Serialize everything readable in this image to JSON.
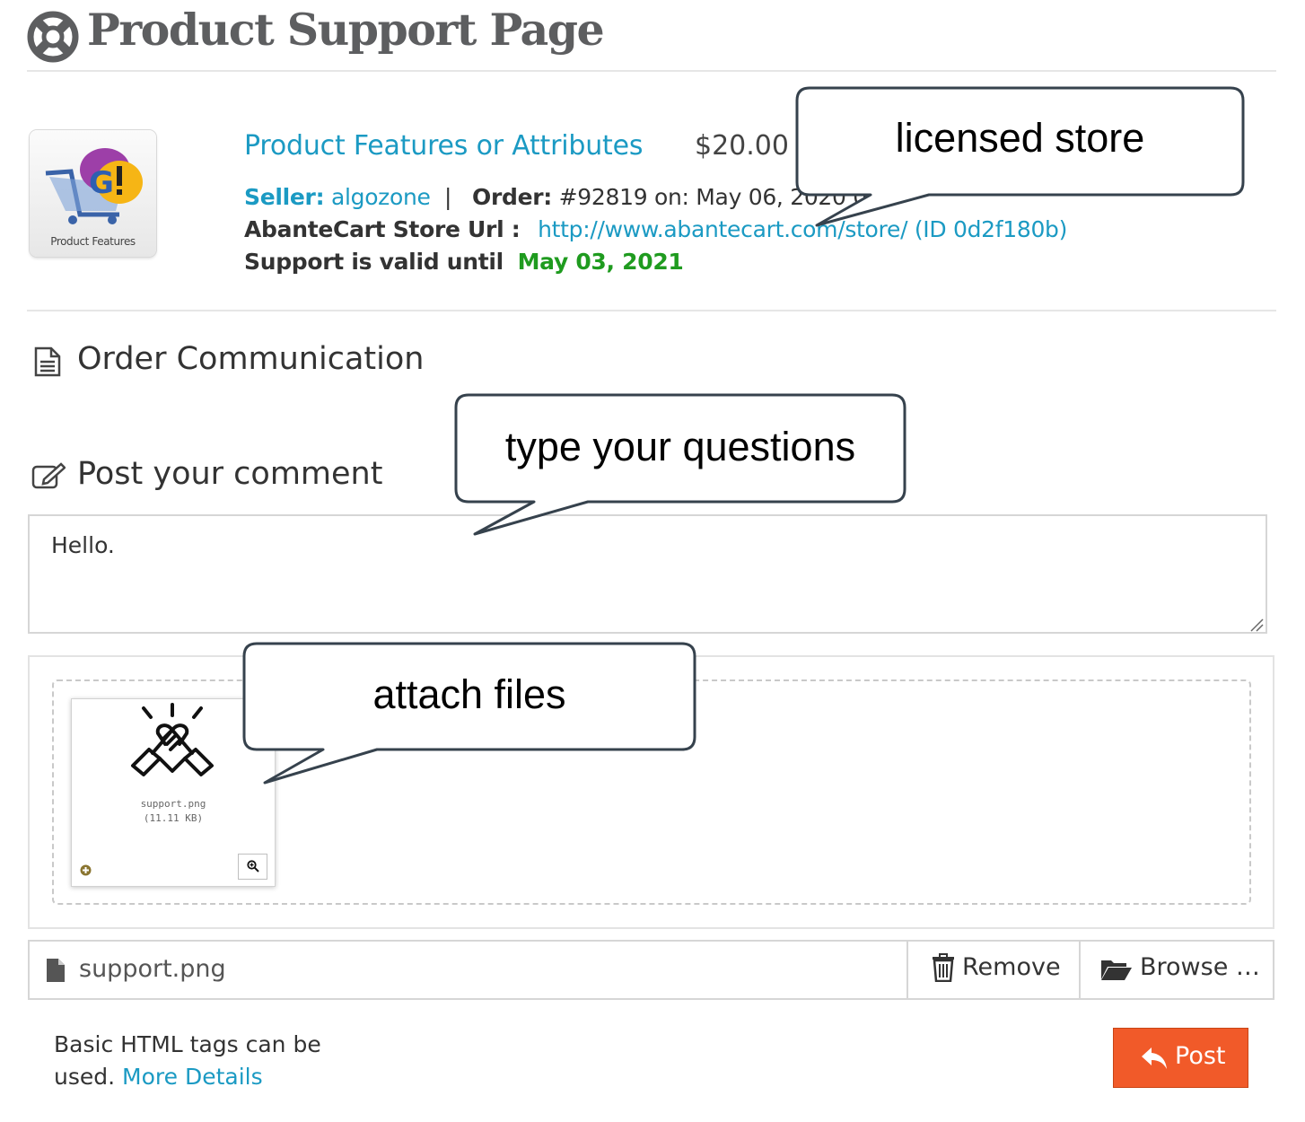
{
  "header": {
    "title": "Product Support Page",
    "icon": "life-ring-icon"
  },
  "product": {
    "thumbnail_label": "Product Features",
    "name": "Product Features or Attributes",
    "price": "$20.00",
    "seller_label": "Seller:",
    "seller": "algozone",
    "order_label": "Order:",
    "order_text": "#92819 on: May 06, 2020 07:5",
    "store_url_label": "AbanteCart Store Url :",
    "store_url": "http://www.abantecart.com/store/ (ID 0d2f180b)",
    "support_label": "Support is valid until",
    "support_until": "May 03, 2021"
  },
  "communication": {
    "title": "Order Communication",
    "icon": "document-icon"
  },
  "comment": {
    "title": "Post your comment",
    "icon": "edit-icon",
    "value": "Hello."
  },
  "upload": {
    "file_name": "support.png",
    "file_size": "(11.11 KB)",
    "input_file_name": "support.png",
    "remove_label": "Remove",
    "browse_label": "Browse …"
  },
  "footer": {
    "help_text": "Basic HTML tags can be used.",
    "more_details": "More Details",
    "post_label": "Post"
  },
  "callouts": {
    "licensed_store": "licensed store",
    "type_questions": "type your questions",
    "attach_files": "attach files"
  },
  "colors": {
    "link": "#1b9ac3",
    "valid_date": "#1f9b1f",
    "post_button": "#f15a29",
    "title": "#5d5e60"
  }
}
